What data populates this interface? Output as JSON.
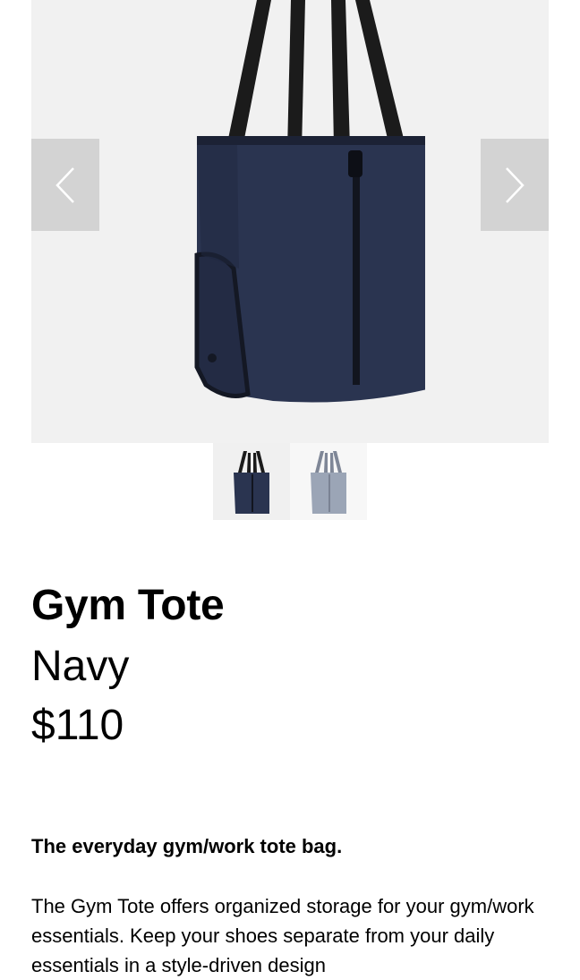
{
  "gallery": {
    "prev_icon": "chevron-left-icon",
    "next_icon": "chevron-right-icon",
    "thumbnails": [
      {
        "color": "#2a3450",
        "selected": true
      },
      {
        "color": "#9ba5b6",
        "selected": false
      }
    ]
  },
  "product": {
    "name": "Gym Tote",
    "color": "Navy",
    "price": "$110",
    "tagline": "The everyday gym/work tote bag.",
    "description": "The Gym Tote offers organized storage for your gym/work essentials. Keep your shoes separate from your daily essentials in a style-driven design"
  },
  "colors": {
    "bag_navy": "#2a3450",
    "bag_grey": "#9ba5b6",
    "gallery_bg": "#f1f1f1",
    "arrow_bg": "#d3d3d3"
  }
}
